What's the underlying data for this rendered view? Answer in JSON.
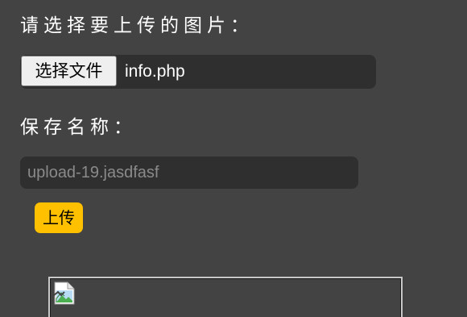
{
  "form": {
    "upload_label": "请选择要上传的图片：",
    "file_button_label": "选择文件",
    "file_name": "info.php",
    "save_name_label": "保存名称：",
    "save_name_placeholder": "upload-19.jasdfasf",
    "submit_label": "上传"
  },
  "preview": {
    "icon": "broken-image-icon"
  },
  "colors": {
    "background": "#434343",
    "field_background": "#2f2f2f",
    "accent": "#ffc000"
  }
}
